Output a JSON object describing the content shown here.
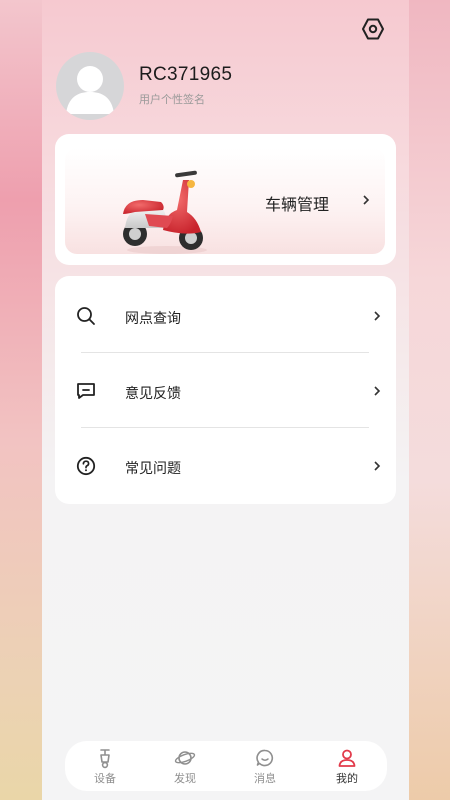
{
  "colors": {
    "accent": "#e23a4a",
    "text_primary": "#222222",
    "text_secondary": "#9a9a9a",
    "card_bg": "#ffffff"
  },
  "header": {
    "settings_icon": "hexagon-settings-icon",
    "username": "RC371965",
    "signature": "用户个性签名"
  },
  "vehicle_card": {
    "label": "车辆管理",
    "image": "red-scooter-illustration"
  },
  "menu": {
    "items": [
      {
        "label": "网点查询",
        "icon": "search-icon"
      },
      {
        "label": "意见反馈",
        "icon": "feedback-icon"
      },
      {
        "label": "常见问题",
        "icon": "question-icon"
      }
    ]
  },
  "tabbar": {
    "items": [
      {
        "label": "设备",
        "icon": "scooter-device-icon",
        "active": false
      },
      {
        "label": "发现",
        "icon": "planet-icon",
        "active": false
      },
      {
        "label": "消息",
        "icon": "chat-bubble-icon",
        "active": false
      },
      {
        "label": "我的",
        "icon": "person-icon",
        "active": true
      }
    ]
  }
}
